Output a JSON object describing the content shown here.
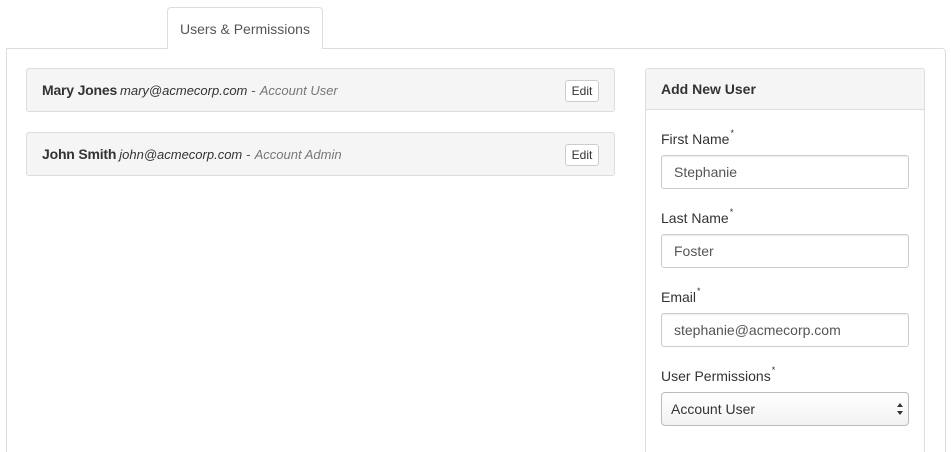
{
  "tabs": [
    {
      "label": "Users & Permissions"
    }
  ],
  "users": [
    {
      "name": "Mary Jones",
      "email": "mary@acmecorp.com",
      "separator": "-",
      "role": "Account User",
      "edit_label": "Edit"
    },
    {
      "name": "John Smith",
      "email": "john@acmecorp.com",
      "separator": "-",
      "role": "Account Admin",
      "edit_label": "Edit"
    }
  ],
  "add_user": {
    "title": "Add New User",
    "required_marker": "*",
    "first_name": {
      "label": "First Name",
      "value": "Stephanie"
    },
    "last_name": {
      "label": "Last Name",
      "value": "Foster"
    },
    "email": {
      "label": "Email",
      "value": "stephanie@acmecorp.com"
    },
    "permissions": {
      "label": "User Permissions",
      "selected": "Account User"
    }
  },
  "icons": {
    "select_arrows": "up-down-caret-icon"
  }
}
